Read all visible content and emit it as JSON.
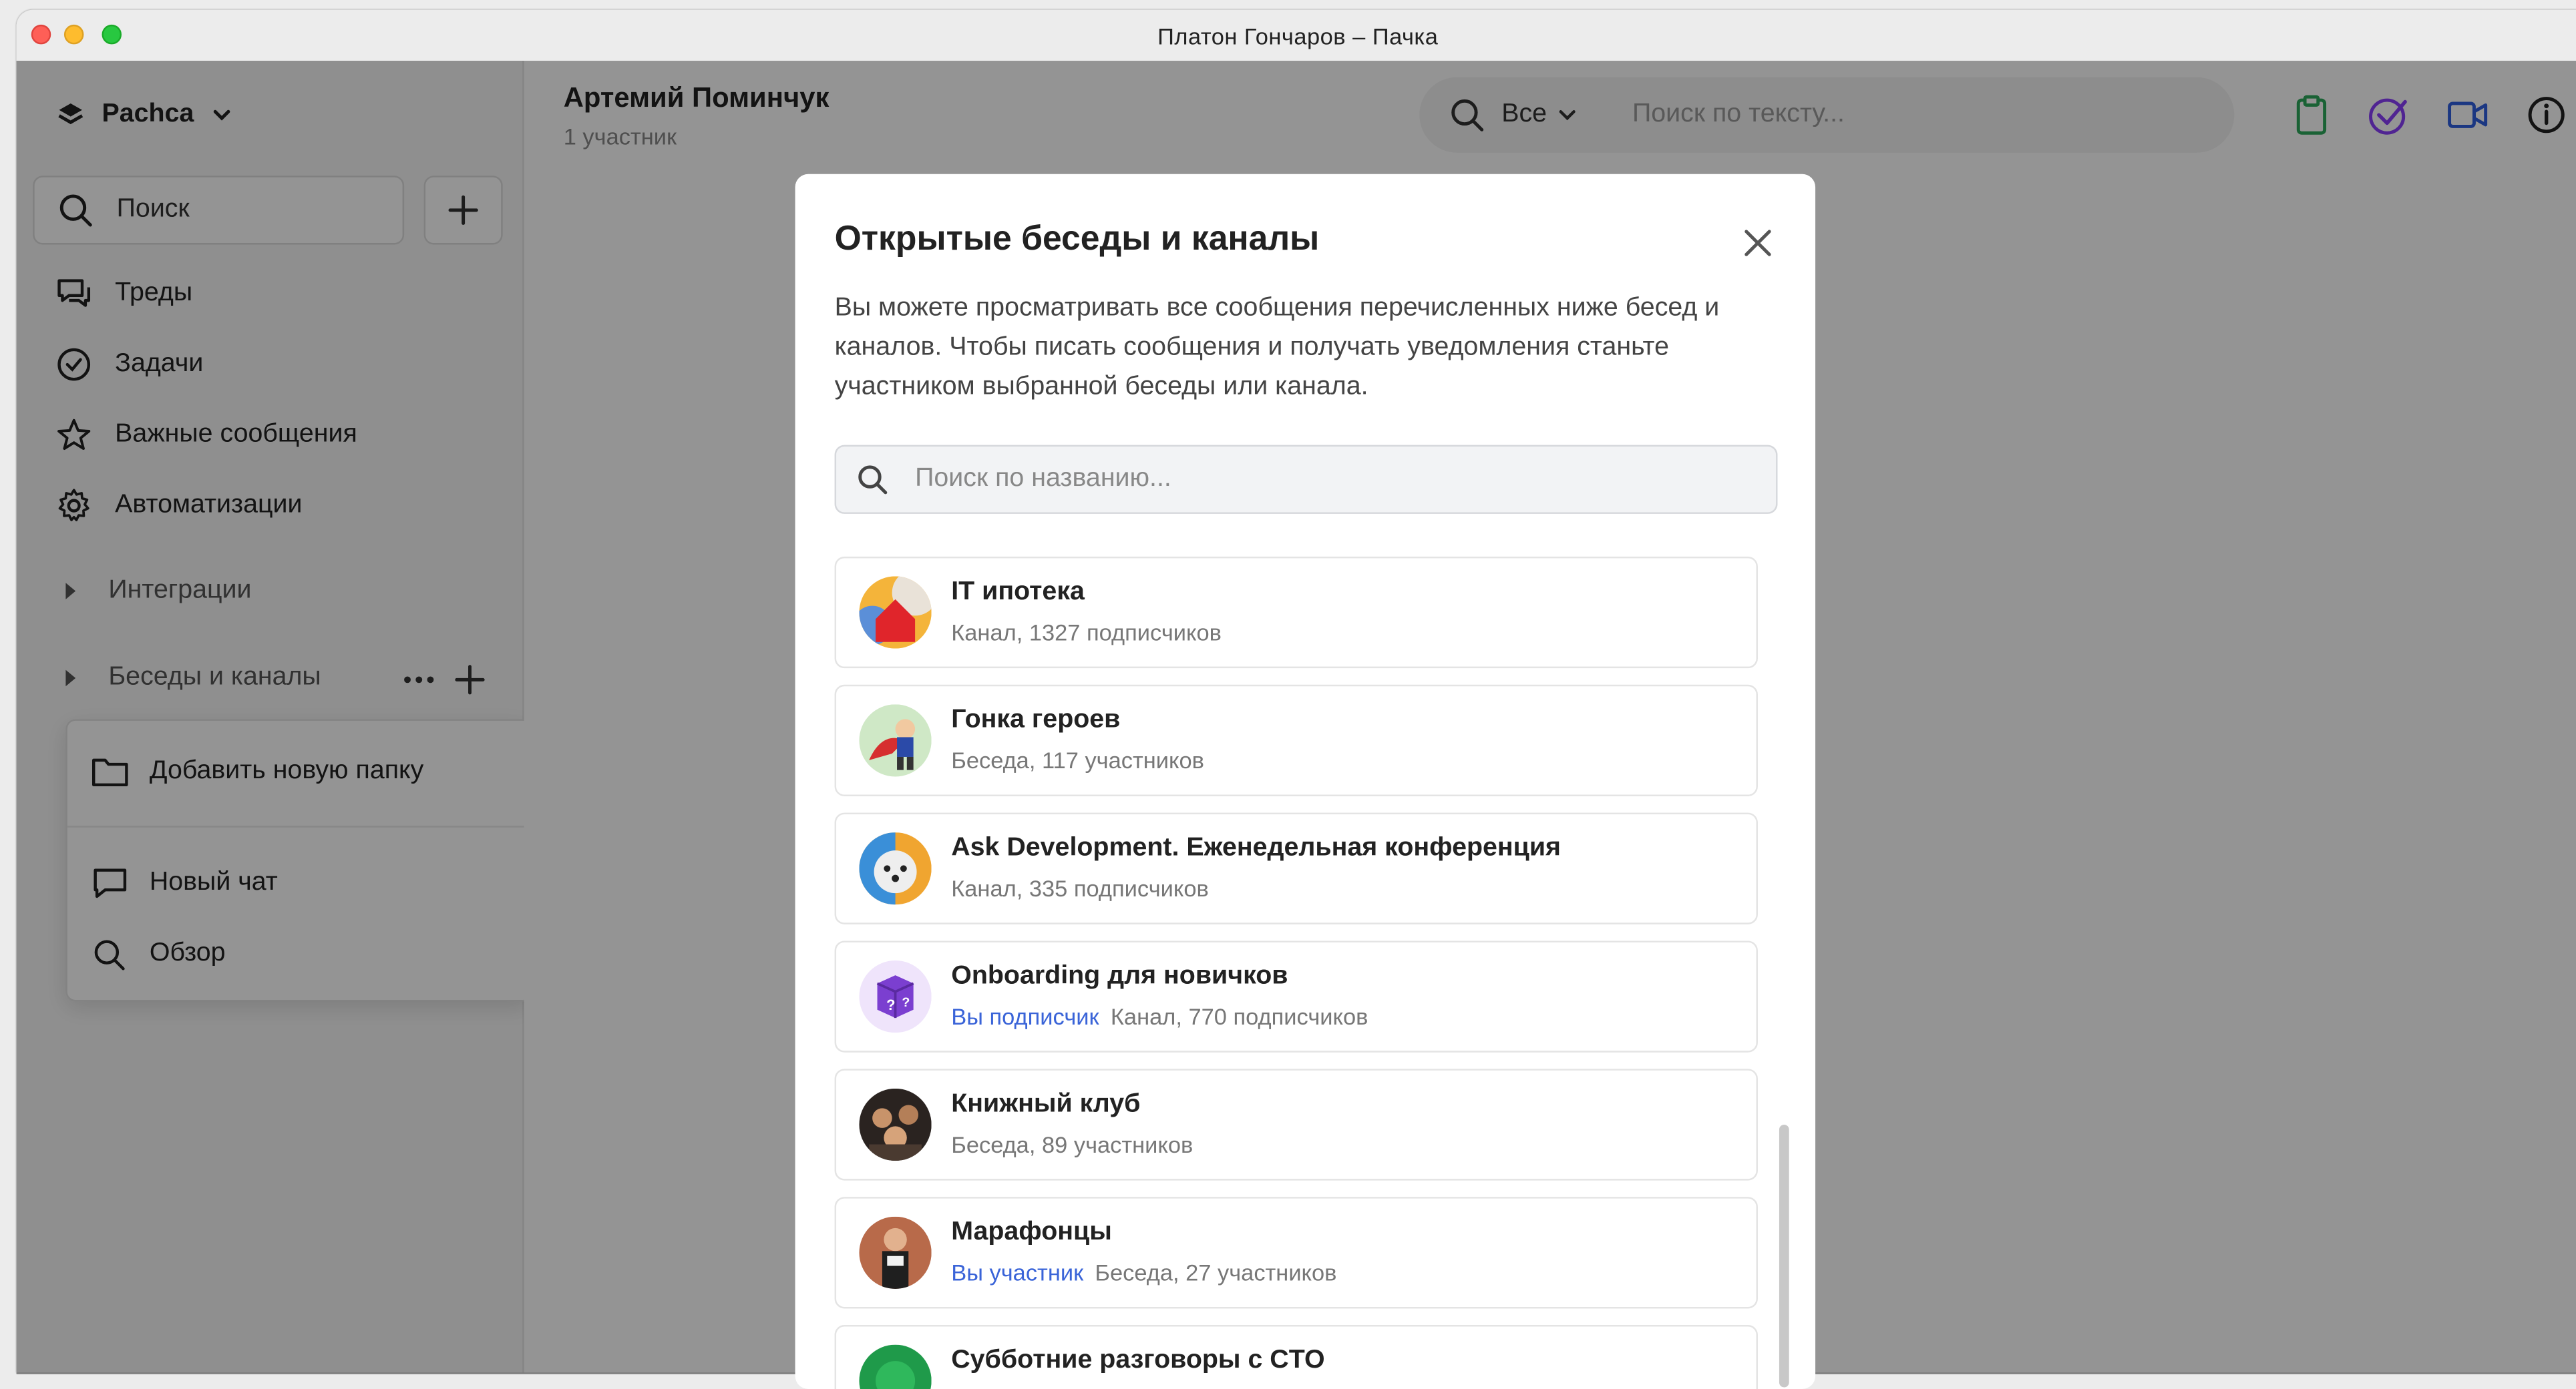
{
  "window": {
    "title": "Платон Гончаров – Пачка"
  },
  "sidebar": {
    "workspace": "Pachca",
    "search_label": "Поиск",
    "nav": [
      {
        "label": "Треды",
        "icon": "threads-icon"
      },
      {
        "label": "Задачи",
        "icon": "check-circle-icon"
      },
      {
        "label": "Важные сообщения",
        "icon": "star-icon"
      },
      {
        "label": "Автоматизации",
        "icon": "gear-icon"
      }
    ],
    "sections": [
      {
        "label": "Интеграции"
      },
      {
        "label": "Беседы и каналы"
      }
    ],
    "dropdown": {
      "add_folder": "Добавить новую папку",
      "new_chat": "Новый чат",
      "browse": "Обзор"
    }
  },
  "main": {
    "chat_title": "Артемий Поминчук",
    "chat_subtitle": "1 участник",
    "search_filter": "Все",
    "search_placeholder": "Поиск по тексту..."
  },
  "modal": {
    "title": "Открытые беседы и каналы",
    "description": "Вы можете просматривать все сообщения перечисленных ниже бесед и каналов. Чтобы писать сообщения и получать уведомления станьте участником выбранной беседы или канала.",
    "search_placeholder": "Поиск по названию...",
    "items": [
      {
        "name": "IT ипотека",
        "badge": "",
        "meta": "Канал, 1327 подписчиков"
      },
      {
        "name": "Гонка героев",
        "badge": "",
        "meta": "Беседа, 117 участников"
      },
      {
        "name": "Ask Development. Еженедельная конференция",
        "badge": "",
        "meta": "Канал, 335 подписчиков"
      },
      {
        "name": "Onboarding для новичков",
        "badge": "Вы подписчик",
        "meta": "Канал, 770 подписчиков"
      },
      {
        "name": "Книжный клуб",
        "badge": "",
        "meta": "Беседа, 89 участников"
      },
      {
        "name": "Марафонцы",
        "badge": "Вы участник",
        "meta": "Беседа, 27 участников"
      },
      {
        "name": "Субботние разговоры с CTO",
        "badge": "",
        "meta": ""
      }
    ]
  },
  "colors": {
    "accent": "#3a64d8",
    "tasks_icon": "#8a3ffc",
    "clipboard_icon": "#2eaa5c",
    "video_icon": "#2f5fe0"
  }
}
